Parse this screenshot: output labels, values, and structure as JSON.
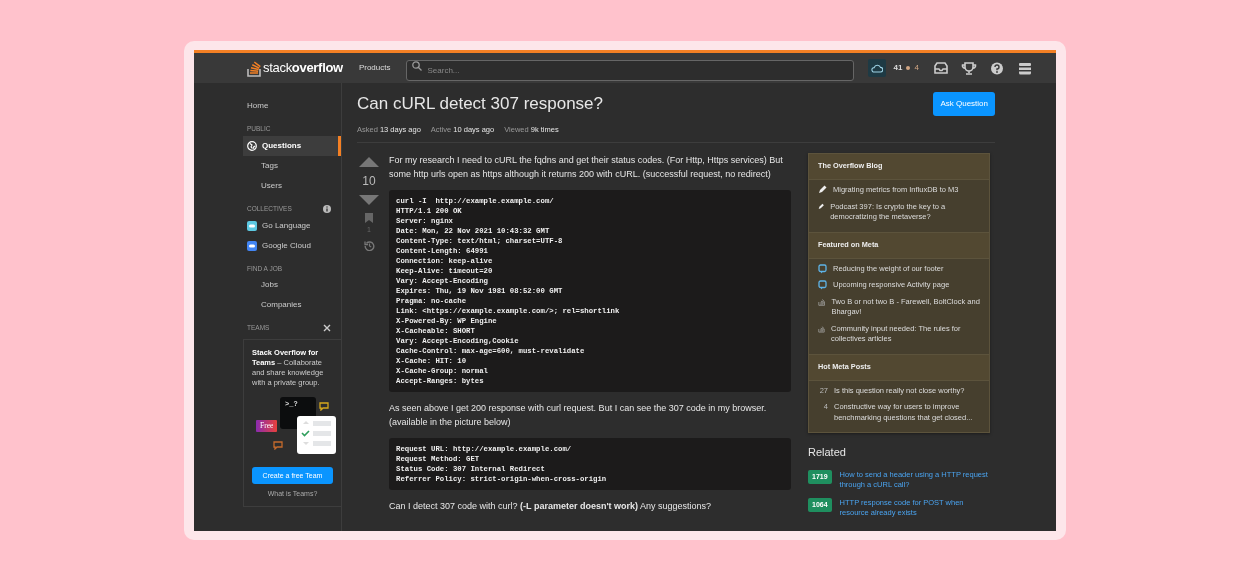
{
  "topbar": {
    "logo_light": "stack",
    "logo_bold": "overflow",
    "products": "Products",
    "search": {
      "placeholder": "Search..."
    },
    "reputation": "41",
    "bronze": "4"
  },
  "sidebar": {
    "items": [
      {
        "kind": "top",
        "label": "Home",
        "selected": false
      },
      {
        "kind": "heading",
        "label": "PUBLIC"
      },
      {
        "kind": "main",
        "label": "Questions",
        "selected": true
      },
      {
        "kind": "sub",
        "label": "Tags",
        "selected": false
      },
      {
        "kind": "sub",
        "label": "Users",
        "selected": false
      },
      {
        "kind": "heading",
        "label": "COLLECTIVES",
        "info": true
      },
      {
        "kind": "collective",
        "label": "Go Language",
        "selected": false,
        "color": "#5dc9e2"
      },
      {
        "kind": "collective",
        "label": "Google Cloud",
        "selected": false,
        "color": "#4285f4"
      },
      {
        "kind": "heading",
        "label": "FIND A JOB"
      },
      {
        "kind": "sub",
        "label": "Jobs",
        "selected": false
      },
      {
        "kind": "sub",
        "label": "Companies",
        "selected": false
      },
      {
        "kind": "heading",
        "label": "TEAMS",
        "closable": true
      }
    ],
    "teams": {
      "text": "**Stack Overflow for Teams** – Collaborate and share knowledge with a private group.",
      "terminal": ">_?",
      "badge": "Free",
      "button": "Create a free Team",
      "link": "What is Teams?"
    }
  },
  "question": {
    "title": "Can cURL detect 307 response?",
    "ask_button": "Ask Question",
    "meta": [
      {
        "label": "Asked",
        "value": "13 days ago"
      },
      {
        "label": "Active",
        "value": "10 days ago"
      },
      {
        "label": "Viewed",
        "value": "9k times"
      }
    ],
    "votes": "10",
    "bookmarks": "1",
    "body": [
      {
        "kind": "text",
        "text": "For my research I need to cURL the fqdns and get their status codes. (For Http, Https services) But some http urls open as https although it returns 200 with cURL. (successful request, no redirect)"
      },
      {
        "kind": "code",
        "lines": [
          "curl -I  http://example.example.com/",
          "HTTP/1.1 200 OK",
          "Server: nginx",
          "Date: Mon, 22 Nov 2021 10:43:32 GMT",
          "Content-Type: text/html; charset=UTF-8",
          "Content-Length: 64991",
          "Connection: keep-alive",
          "Keep-Alive: timeout=20",
          "Vary: Accept-Encoding",
          "Expires: Thu, 19 Nov 1981 08:52:00 GMT",
          "Pragma: no-cache",
          "Link: <https://example.example.com/>; rel=shortlink",
          "X-Powered-By: WP Engine",
          "X-Cacheable: SHORT",
          "Vary: Accept-Encoding,Cookie",
          "Cache-Control: max-age=600, must-revalidate",
          "X-Cache: HIT: 10",
          "X-Cache-Group: normal",
          "Accept-Ranges: bytes"
        ]
      },
      {
        "kind": "text",
        "text": "As seen above I get 200 response with curl request. But I can see the 307 code in my browser. (available in the picture below)"
      },
      {
        "kind": "code",
        "lines": [
          "Request URL: http://example.example.com/",
          "Request Method: GET",
          "Status Code: 307 Internal Redirect",
          "Referrer Policy: strict-origin-when-cross-origin"
        ]
      },
      {
        "kind": "text",
        "text": "Can I detect 307 code with curl? **(-L parameter doesn't work)** Any suggestions?"
      }
    ]
  },
  "widgets": [
    {
      "title": "The Overflow Blog",
      "items": [
        {
          "kind": "blog",
          "text": "Migrating metrics from InfluxDB to M3"
        },
        {
          "kind": "blog",
          "text": "Podcast 397: Is crypto the key to a democratizing the metaverse?"
        }
      ]
    },
    {
      "title": "Featured on Meta",
      "items": [
        {
          "kind": "meta",
          "text": "Reducing the weight of our footer"
        },
        {
          "kind": "meta",
          "text": "Upcoming responsive Activity page"
        },
        {
          "kind": "stack",
          "text": "Two B or not two B - Farewell, BoltClock and Bhargav!"
        },
        {
          "kind": "stack",
          "text": "Community input needed: The rules for collectives articles"
        }
      ]
    },
    {
      "title": "Hot Meta Posts",
      "items": [
        {
          "kind": "count",
          "count": "27",
          "text": "Is this question really not close worthy?"
        },
        {
          "kind": "count",
          "count": "4",
          "text": "Constructive way for users to improve benchmarking questions that get closed..."
        }
      ]
    }
  ],
  "related": {
    "title": "Related",
    "items": [
      {
        "score": "1719",
        "text": "How to send a header using a HTTP request through a cURL call?"
      },
      {
        "score": "1064",
        "text": "HTTP response code for POST when resource already exists"
      }
    ]
  }
}
